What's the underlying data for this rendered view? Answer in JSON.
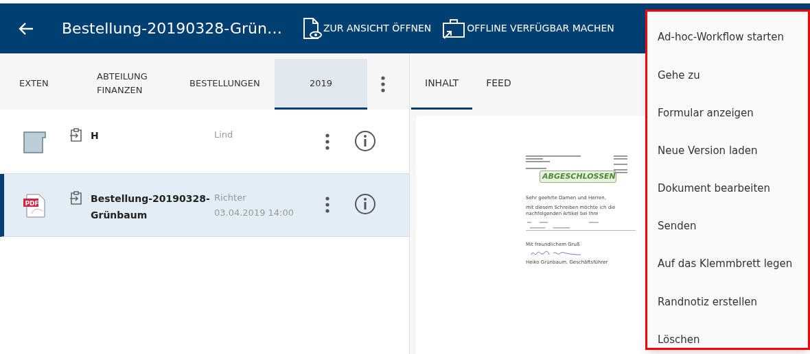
{
  "header": {
    "title": "Bestellung-20190328-Grün…",
    "actions": [
      {
        "kind": "view",
        "label": "ZUR ANSICHT ÖFFNEN"
      },
      {
        "kind": "offline",
        "label": "OFFLINE VERFÜGBAR MACHEN"
      }
    ]
  },
  "path_tabs": [
    {
      "label": "EXTEN",
      "selected": false
    },
    {
      "label": "ABTEILUNG FINANZEN",
      "selected": false
    },
    {
      "label": "BESTELLUNGEN",
      "selected": false
    },
    {
      "label": "2019",
      "selected": true
    }
  ],
  "rows": [
    {
      "kind": "folder",
      "name": "H",
      "author": "Lind",
      "selected": false
    },
    {
      "kind": "pdf",
      "icon_label": "PDF",
      "name": "Bestellung-20190328-Grünbaum",
      "author": "Richter",
      "date": "03.04.2019 14:00",
      "selected": true
    }
  ],
  "detail_tabs": [
    {
      "label": "INHALT",
      "selected": true
    },
    {
      "label": "FEED",
      "selected": false
    }
  ],
  "preview": {
    "stamp": "ABGESCHLOSSEN",
    "greeting": "Sehr geehrte Damen und Herren,",
    "body": "mit diesem Schreiben möchte ich die nachfolgenden Artikel bei Ihre",
    "closing": "Mit freundlichem Gruß",
    "signer": "Heiko Grünbaum, Geschäftsführer"
  },
  "menu": [
    "Ad-hoc-Workflow starten",
    "Gehe zu",
    "Formular anzeigen",
    "Neue Version laden",
    "Dokument bearbeiten",
    "Senden",
    "Auf das Klemmbrett legen",
    "Randnotiz erstellen",
    "Löschen"
  ]
}
